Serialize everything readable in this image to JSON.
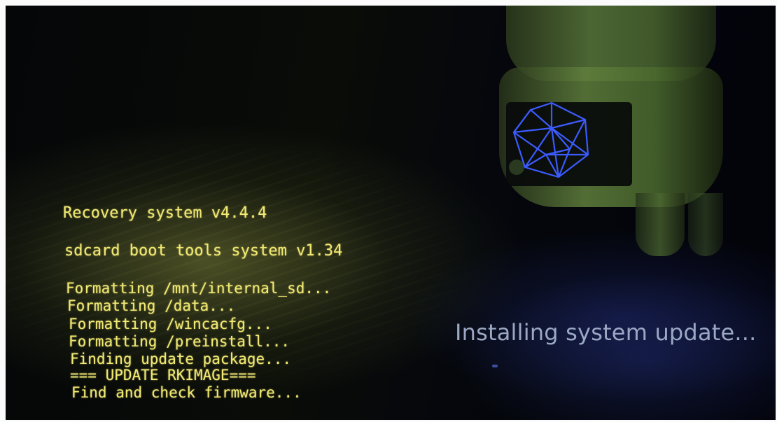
{
  "recovery_log": {
    "title_line": "Recovery system v4.4.4",
    "tools_line": "sdcard boot tools system v1.34",
    "lines": [
      "Formatting /mnt/internal_sd...",
      "Formatting /data...",
      "Formatting /wincacfg...",
      "Formatting /preinstall...",
      "Finding update package...",
      "=== UPDATE RKIMAGE===",
      "Find and check firmware..."
    ]
  },
  "status": {
    "message": "Installing system update..."
  },
  "colors": {
    "log_text": "#f2ea74",
    "status_text": "#9aa8c4",
    "robot_green": "#607f3c",
    "gem_blue": "#3b5bff"
  },
  "icons": {
    "robot": "android-robot-icon",
    "gem": "blue-icosahedron-icon"
  }
}
